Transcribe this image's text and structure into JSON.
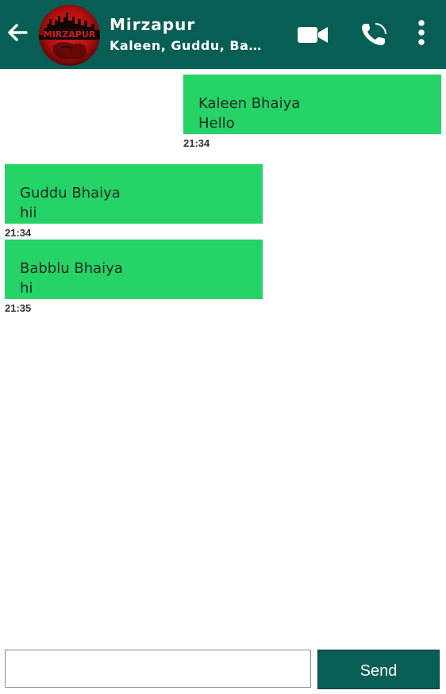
{
  "header": {
    "back_icon": "arrow-left-icon",
    "group_name": "Mirzapur",
    "members": "Kaleen, Guddu, Babl...",
    "avatar_logo_text": "MIRZAPUR",
    "video_icon": "video-camera-icon",
    "call_icon": "phone-icon",
    "more_icon": "more-vertical-icon"
  },
  "messages": [
    {
      "sender": "Kaleen Bhaiya",
      "text": "Hello",
      "time": "21:34",
      "side": "outgoing"
    },
    {
      "sender": "Guddu Bhaiya",
      "text": "hii",
      "time": "21:34",
      "side": "incoming"
    },
    {
      "sender": "Babblu Bhaiya",
      "text": "hi",
      "time": "21:35",
      "side": "incoming"
    }
  ],
  "composer": {
    "input_value": "",
    "send_label": "Send"
  },
  "colors": {
    "header": "#075e54",
    "bubble": "#25d366",
    "send_button": "#075e54"
  }
}
